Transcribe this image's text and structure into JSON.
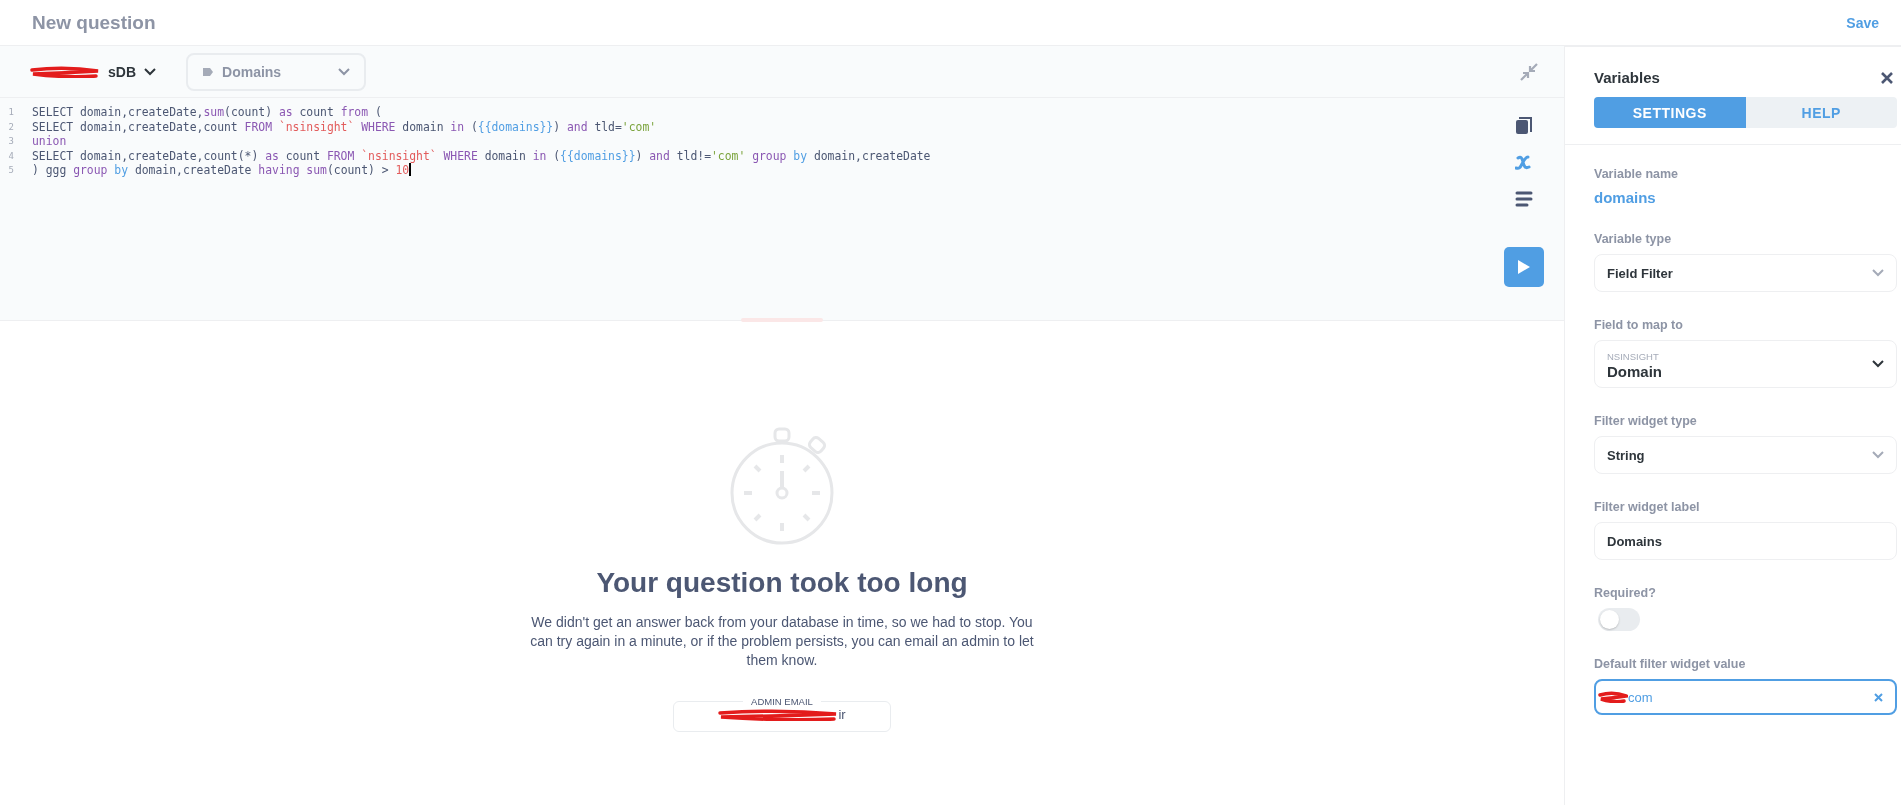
{
  "header": {
    "title": "New question",
    "save": "Save"
  },
  "toolbar": {
    "database": "sDB",
    "table_select": "Domains"
  },
  "editor": {
    "lines": [
      {
        "number": "1",
        "tokens": [
          {
            "kind": "plain",
            "text": "SELECT domain,createDate,"
          },
          {
            "kind": "keyword",
            "text": "sum"
          },
          {
            "kind": "plain",
            "text": "(count) "
          },
          {
            "kind": "keyword",
            "text": "as"
          },
          {
            "kind": "plain",
            "text": " count "
          },
          {
            "kind": "keyword",
            "text": "from"
          },
          {
            "kind": "plain",
            "text": " ("
          }
        ]
      },
      {
        "number": "2",
        "tokens": [
          {
            "kind": "plain",
            "text": "SELECT domain,createDate,count "
          },
          {
            "kind": "keyword",
            "text": "FROM"
          },
          {
            "kind": "table",
            "text": " `nsinsight` "
          },
          {
            "kind": "keyword",
            "text": "WHERE"
          },
          {
            "kind": "plain",
            "text": " domain "
          },
          {
            "kind": "keyword",
            "text": "in"
          },
          {
            "kind": "plain",
            "text": " ("
          },
          {
            "kind": "variable",
            "text": "{{domains}}"
          },
          {
            "kind": "plain",
            "text": ") "
          },
          {
            "kind": "keyword",
            "text": "and"
          },
          {
            "kind": "plain",
            "text": " tld="
          },
          {
            "kind": "string",
            "text": "'com'"
          }
        ]
      },
      {
        "number": "3",
        "tokens": [
          {
            "kind": "keyword",
            "text": "union"
          }
        ]
      },
      {
        "number": "4",
        "tokens": [
          {
            "kind": "plain",
            "text": "SELECT domain,createDate,count(*) "
          },
          {
            "kind": "keyword",
            "text": "as"
          },
          {
            "kind": "plain",
            "text": " count "
          },
          {
            "kind": "keyword",
            "text": "FROM"
          },
          {
            "kind": "table",
            "text": " `nsinsight` "
          },
          {
            "kind": "keyword",
            "text": "WHERE"
          },
          {
            "kind": "plain",
            "text": " domain "
          },
          {
            "kind": "keyword",
            "text": "in"
          },
          {
            "kind": "plain",
            "text": " ("
          },
          {
            "kind": "variable",
            "text": "{{domains}}"
          },
          {
            "kind": "plain",
            "text": ") "
          },
          {
            "kind": "keyword",
            "text": "and"
          },
          {
            "kind": "plain",
            "text": " tld!="
          },
          {
            "kind": "string",
            "text": "'com'"
          },
          {
            "kind": "keyword",
            "text": " group "
          },
          {
            "kind": "builtin",
            "text": "by"
          },
          {
            "kind": "plain",
            "text": " domain,createDate"
          }
        ]
      },
      {
        "number": "5",
        "tokens": [
          {
            "kind": "plain",
            "text": ") ggg "
          },
          {
            "kind": "keyword",
            "text": "group "
          },
          {
            "kind": "builtin",
            "text": "by"
          },
          {
            "kind": "plain",
            "text": " domain,createDate "
          },
          {
            "kind": "keyword",
            "text": "having sum"
          },
          {
            "kind": "plain",
            "text": "(count) > "
          },
          {
            "kind": "number",
            "text": "10"
          }
        ]
      }
    ]
  },
  "result": {
    "title": "Your question took too long",
    "message": "We didn't get an answer back from your database in time, so we had to stop. You can try again in a minute, or if the problem persists, you can email an admin to let them know.",
    "email_label": "ADMIN EMAIL",
    "email": "ir"
  },
  "panel": {
    "title": "Variables",
    "tabs": [
      {
        "label": "SETTINGS",
        "selected": true
      },
      {
        "label": "HELP",
        "selected": false
      }
    ],
    "fields": [
      {
        "kind": "static",
        "label": "Variable name",
        "value": "domains"
      },
      {
        "kind": "select",
        "label": "Variable type",
        "value": "Field Filter"
      },
      {
        "kind": "mapped",
        "label": "Field to map to",
        "table": "NSINSIGHT",
        "value": "Domain"
      },
      {
        "kind": "select",
        "label": "Filter widget type",
        "value": "String"
      },
      {
        "kind": "input",
        "label": "Filter widget label",
        "value": "Domains"
      },
      {
        "kind": "toggle",
        "label": "Required?",
        "on": false
      },
      {
        "kind": "clearable",
        "label": "Default filter widget value",
        "value": "com"
      }
    ]
  }
}
